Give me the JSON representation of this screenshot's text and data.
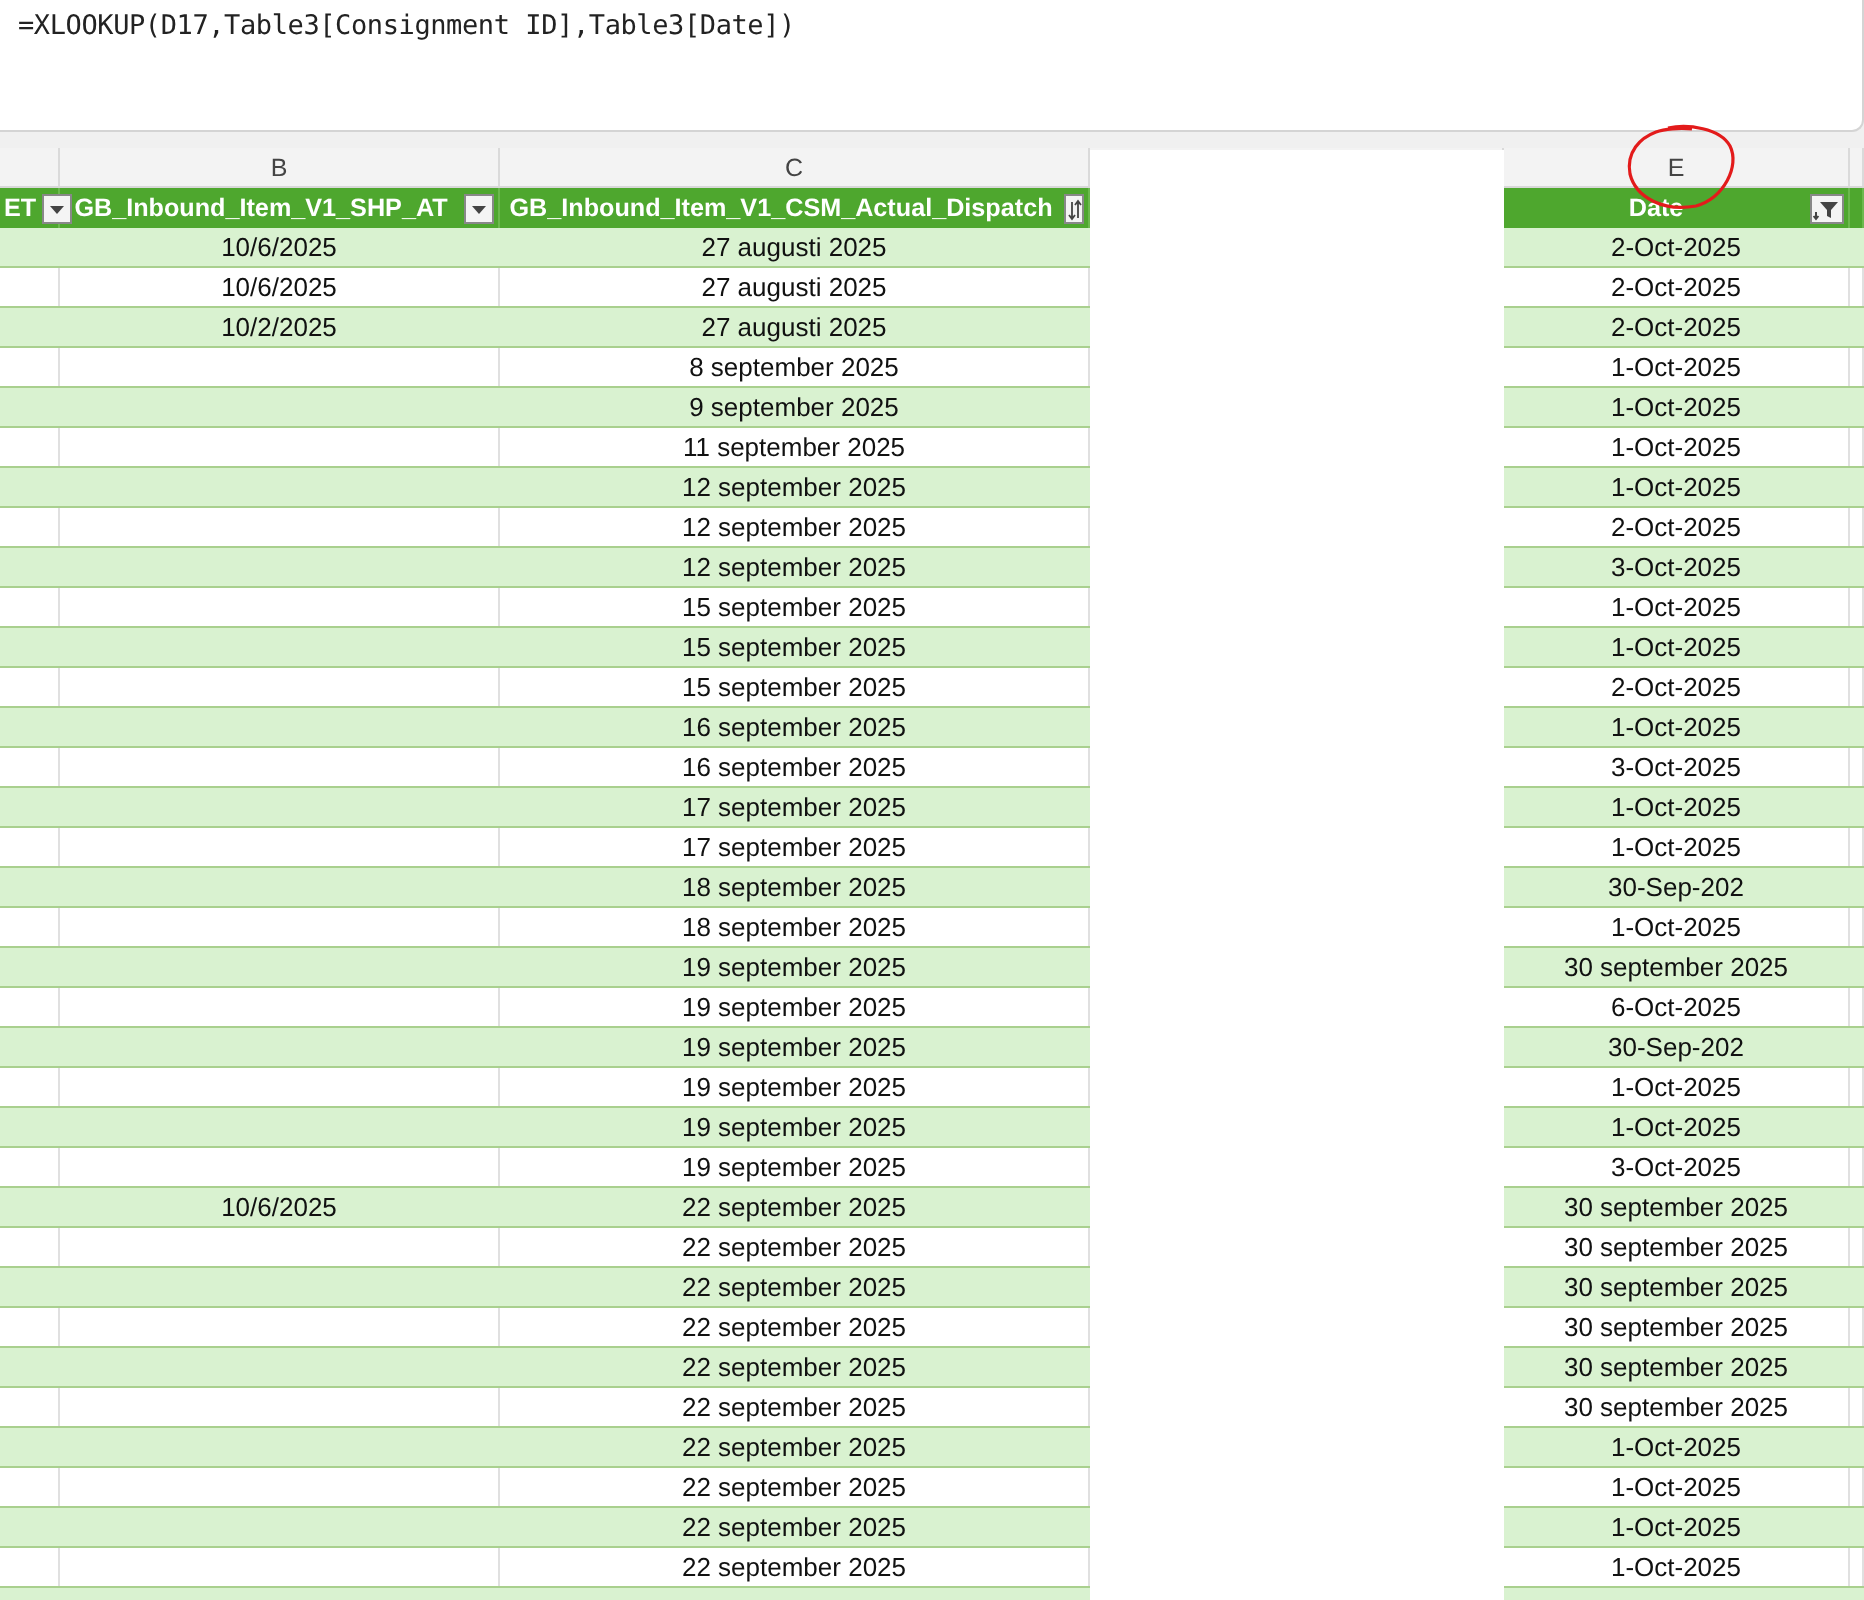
{
  "formula_bar": {
    "text": "=XLOOKUP(D17,Table3[Consignment ID],Table3[Date])"
  },
  "column_letters": [
    {
      "letter": "B",
      "circled": false
    },
    {
      "letter": "C",
      "circled": false
    },
    {
      "letter": "E",
      "circled": true
    }
  ],
  "table": {
    "columns": [
      {
        "header": "ET",
        "kind": "dropdown"
      },
      {
        "header": "GB_Inbound_Item_V1_SHP_AT",
        "kind": "dropdown"
      },
      {
        "header": "GB_Inbound_Item_V1_CSM_Actual_Dispatch",
        "kind": "sort"
      },
      {
        "header": "Date",
        "kind": "filter"
      }
    ],
    "rows": [
      {
        "ship_ata": "10/6/2025",
        "dispatch": "27 augusti 2025",
        "date": "2-Oct-2025"
      },
      {
        "ship_ata": "10/6/2025",
        "dispatch": "27 augusti 2025",
        "date": "2-Oct-2025"
      },
      {
        "ship_ata": "10/2/2025",
        "dispatch": "27 augusti 2025",
        "date": "2-Oct-2025"
      },
      {
        "dispatch": "8 september 2025",
        "date": "1-Oct-2025"
      },
      {
        "dispatch": "9 september 2025",
        "date": "1-Oct-2025"
      },
      {
        "dispatch": "11 september 2025",
        "date": "1-Oct-2025"
      },
      {
        "dispatch": "12 september 2025",
        "date": "1-Oct-2025"
      },
      {
        "dispatch": "12 september 2025",
        "date": "2-Oct-2025"
      },
      {
        "dispatch": "12 september 2025",
        "date": "3-Oct-2025"
      },
      {
        "dispatch": "15 september 2025",
        "date": "1-Oct-2025"
      },
      {
        "dispatch": "15 september 2025",
        "date": "1-Oct-2025"
      },
      {
        "dispatch": "15 september 2025",
        "date": "2-Oct-2025"
      },
      {
        "dispatch": "16 september 2025",
        "date": "1-Oct-2025"
      },
      {
        "dispatch": "16 september 2025",
        "date": "3-Oct-2025"
      },
      {
        "dispatch": "17 september 2025",
        "date": "1-Oct-2025"
      },
      {
        "dispatch": "17 september 2025",
        "date": "1-Oct-2025"
      },
      {
        "dispatch": "18 september 2025",
        "date": "30-Sep-202"
      },
      {
        "dispatch": "18 september 2025",
        "date": "1-Oct-2025"
      },
      {
        "dispatch": "19 september 2025",
        "date": "30 september 2025"
      },
      {
        "dispatch": "19 september 2025",
        "date": "6-Oct-2025"
      },
      {
        "dispatch": "19 september 2025",
        "date": "30-Sep-202"
      },
      {
        "dispatch": "19 september 2025",
        "date": "1-Oct-2025"
      },
      {
        "dispatch": "19 september 2025",
        "date": "1-Oct-2025"
      },
      {
        "dispatch": "19 september 2025",
        "date": "3-Oct-2025"
      },
      {
        "ship_ata": "10/6/2025",
        "dispatch": "22 september 2025",
        "date": "30 september 2025"
      },
      {
        "dispatch": "22 september 2025",
        "date": "30 september 2025"
      },
      {
        "dispatch": "22 september 2025",
        "date": "30 september 2025"
      },
      {
        "dispatch": "22 september 2025",
        "date": "30 september 2025"
      },
      {
        "dispatch": "22 september 2025",
        "date": "30 september 2025"
      },
      {
        "dispatch": "22 september 2025",
        "date": "30 september 2025"
      },
      {
        "dispatch": "22 september 2025",
        "date": "1-Oct-2025"
      },
      {
        "dispatch": "22 september 2025",
        "date": "1-Oct-2025"
      },
      {
        "dispatch": "22 september 2025",
        "date": "1-Oct-2025"
      },
      {
        "dispatch": "22 september 2025",
        "date": "1-Oct-2025"
      }
    ]
  }
}
